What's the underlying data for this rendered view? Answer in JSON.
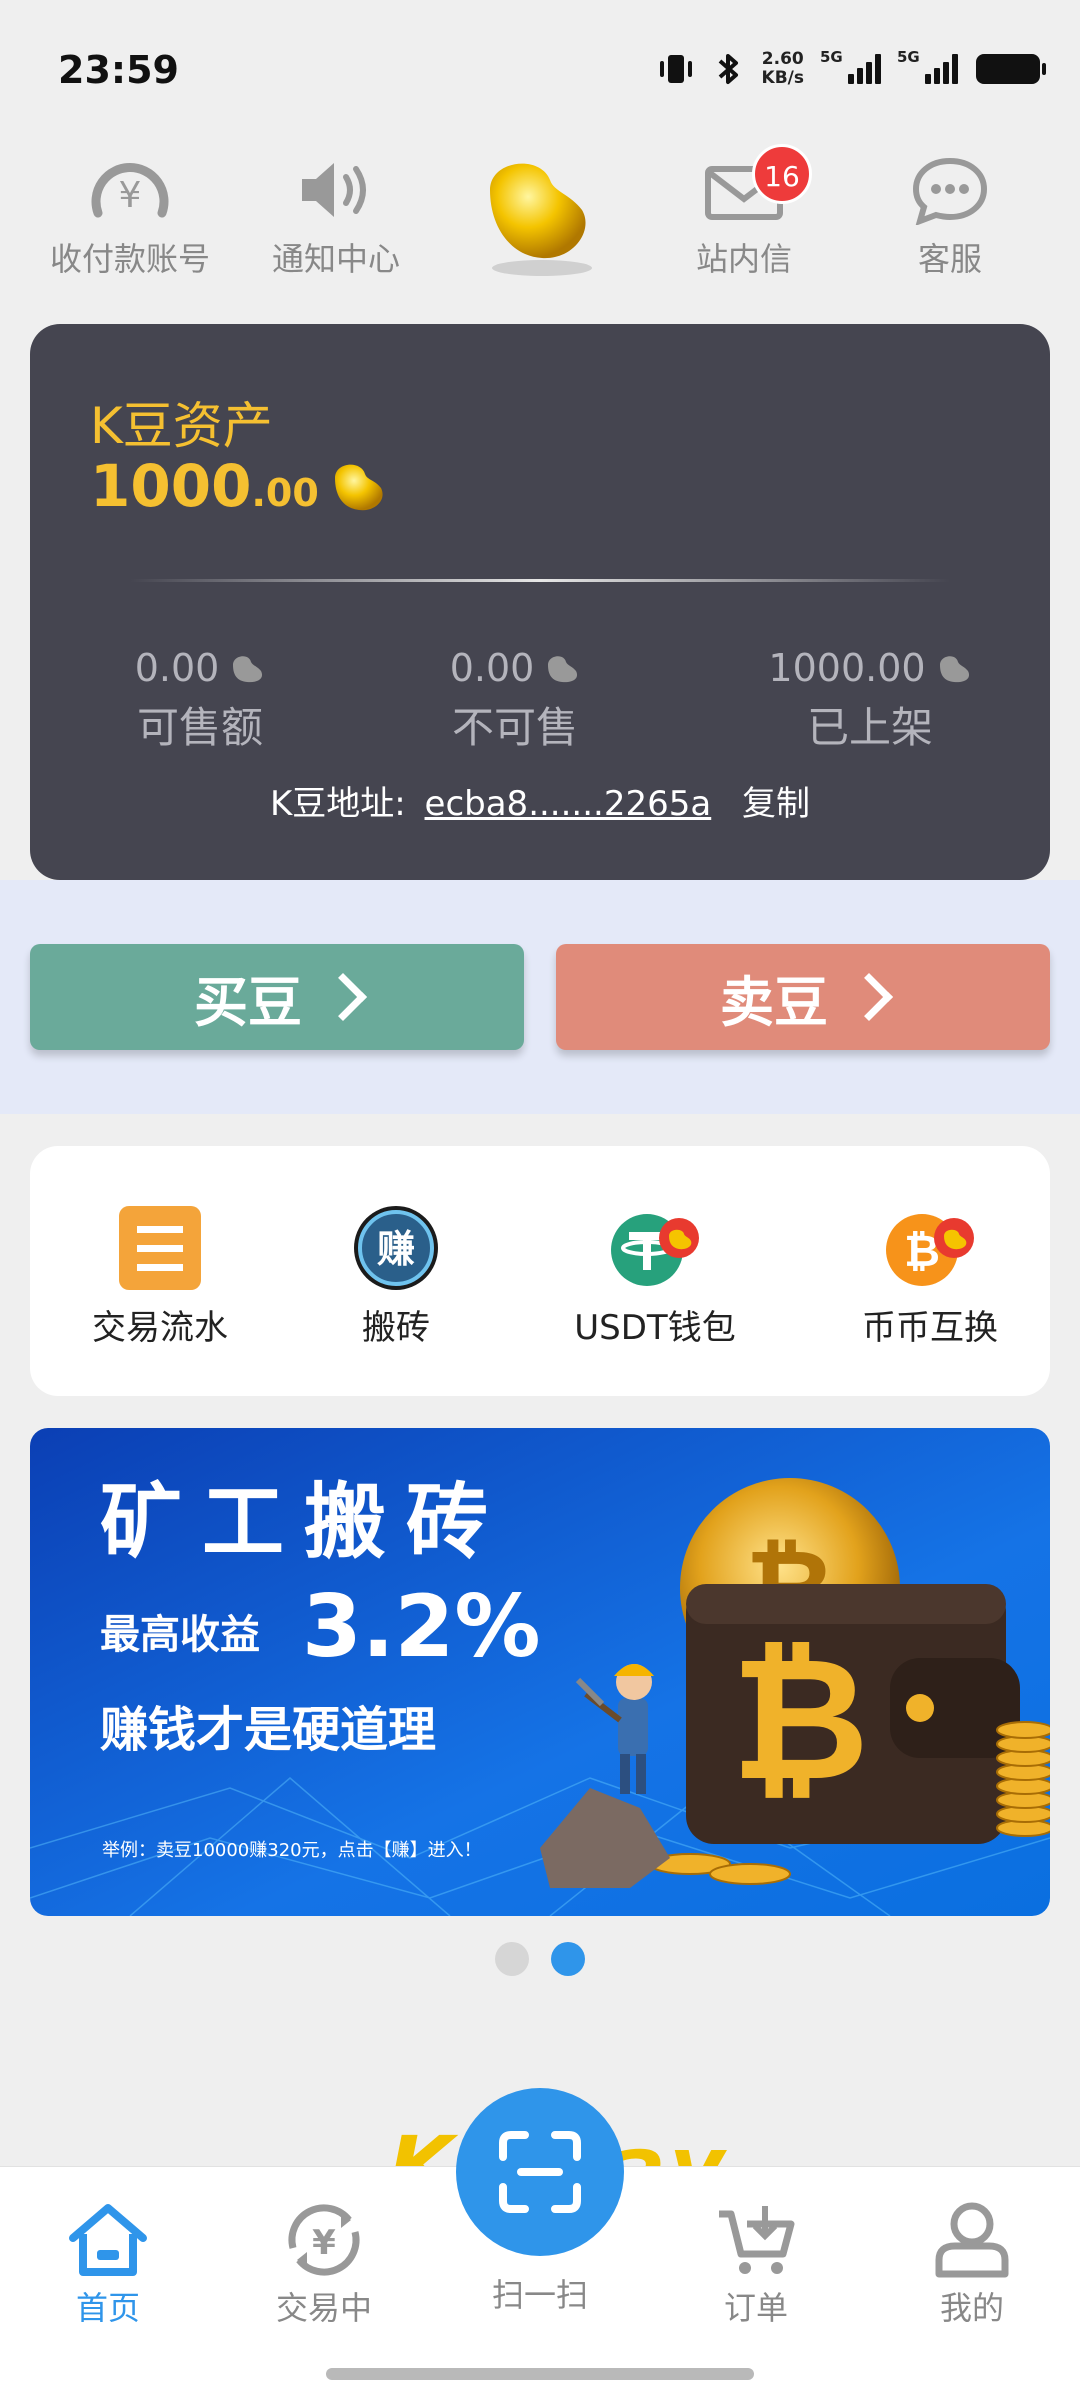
{
  "status_bar": {
    "time": "23:59",
    "speed_value": "2.60",
    "speed_unit": "KB/s",
    "sig1_label": "5G",
    "sig2_label": "5G"
  },
  "top_nav": {
    "items": [
      {
        "label": "收付款账号",
        "icon": "yen-gauge-icon"
      },
      {
        "label": "通知中心",
        "icon": "speaker-icon"
      },
      {
        "label": "站内信",
        "icon": "mail-icon",
        "badge": "16"
      },
      {
        "label": "客服",
        "icon": "chat-icon"
      }
    ]
  },
  "asset": {
    "title": "K豆资产",
    "amount_int": "1000",
    "amount_dec": ".00",
    "stats": [
      {
        "value": "0.00",
        "label": "可售额"
      },
      {
        "value": "0.00",
        "label": "不可售"
      },
      {
        "value": "1000.00",
        "label": "已上架"
      }
    ],
    "address_label": "K豆地址:",
    "address_value": "ecba8.......2265a",
    "copy_label": "复制"
  },
  "actions": {
    "buy_label": "买豆",
    "sell_label": "卖豆"
  },
  "shortcuts": [
    {
      "label": "交易流水",
      "icon": "menu-list-icon"
    },
    {
      "label": "搬砖",
      "icon": "earn-coin-icon",
      "glyph": "赚"
    },
    {
      "label": "USDT钱包",
      "icon": "usdt-wallet-icon"
    },
    {
      "label": "币币互换",
      "icon": "bitcoin-swap-icon"
    }
  ],
  "banner": {
    "headline": "矿工搬砖",
    "line2_prefix": "最高收益",
    "line2_value": "3.2%",
    "line3": "赚钱才是硬道理",
    "footnote": "举例：卖豆10000赚320元，点击【赚】进入！"
  },
  "logo_partial": "K",
  "logo_partial_tail": "ay",
  "tabbar": {
    "tabs": [
      {
        "label": "首页",
        "icon": "home-icon"
      },
      {
        "label": "交易中",
        "icon": "yen-exchange-icon"
      },
      {
        "label": "订单",
        "icon": "cart-icon"
      },
      {
        "label": "我的",
        "icon": "user-icon"
      }
    ],
    "scan_label": "扫一扫"
  },
  "colors": {
    "accent": "#2f95ea",
    "gold": "#f5c031",
    "card_bg": "#454550",
    "buy": "#6aaa9a",
    "sell": "#e08b7a",
    "badge": "#ee3b3b"
  }
}
